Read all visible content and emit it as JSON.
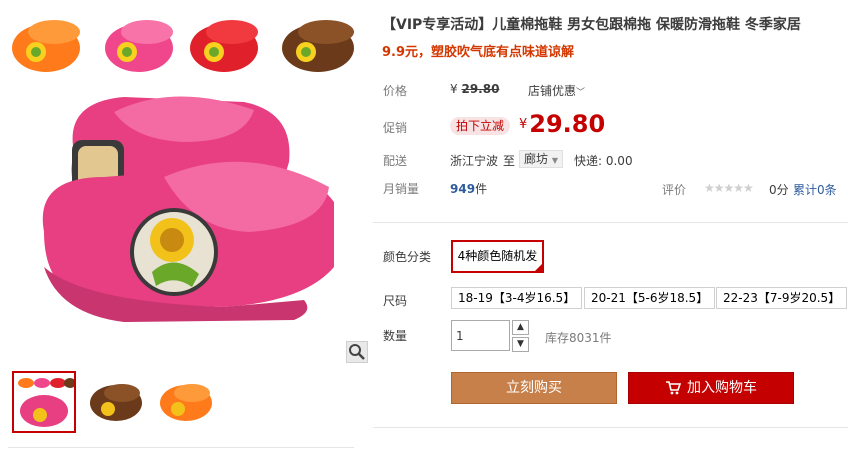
{
  "product": {
    "title": "【VIP专享活动】儿童棉拖鞋 男女包跟棉拖 保暖防滑拖鞋 冬季家居",
    "subtitle": "9.9元，塑胶吹气底有点味道谅解"
  },
  "price": {
    "label": "价格",
    "currency": "¥",
    "original": "29.80",
    "shop_discount": "店铺优惠",
    "shop_discount_icon": "chevron-down-icon"
  },
  "promo": {
    "label": "促销",
    "badge": "拍下立减",
    "currency": "¥",
    "price": "29.80"
  },
  "delivery": {
    "label": "配送",
    "origin": "浙江宁波",
    "to": "至",
    "destination": "廊坊",
    "express": "快递: 0.00"
  },
  "sales": {
    "label": "月销量",
    "count": "949",
    "unit": "件",
    "rating_label": "评价",
    "stars": "★★★★★",
    "score": "0分",
    "reviews": "累计0条"
  },
  "sku": {
    "color_label": "颜色分类",
    "color_option": "4种颜色随机发",
    "size_label": "尺码",
    "sizes": [
      "18-19【3-4岁16.5】",
      "20-21【5-6岁18.5】",
      "22-23【7-9岁20.5】"
    ]
  },
  "quantity": {
    "label": "数量",
    "value": "1",
    "stock": "库存8031件"
  },
  "actions": {
    "buy_now": "立刻购买",
    "add_to_cart": "加入购物车"
  },
  "colors": {
    "accent_red": "#c40000",
    "buy_button": "#c8804b",
    "slipper_pink": "#e83e82",
    "link_blue": "#2e5c9f"
  },
  "icons": {
    "zoom": "magnifier-icon",
    "cart": "cart-icon"
  }
}
